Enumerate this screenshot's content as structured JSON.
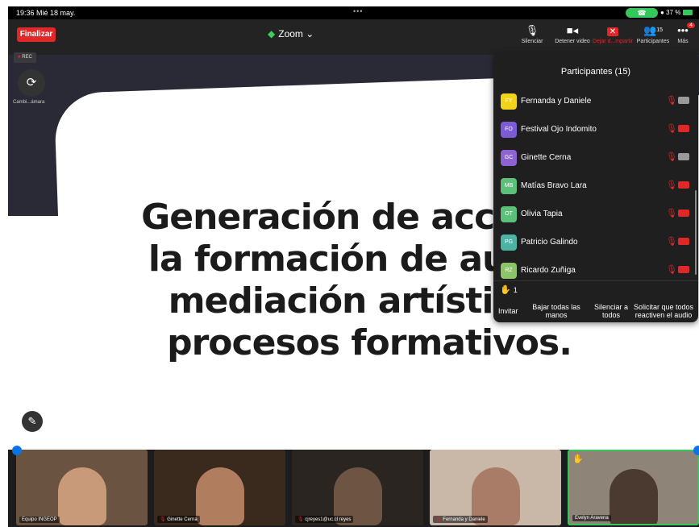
{
  "status_bar": {
    "time": "19:36  Mié 18 may.",
    "battery": "37 %"
  },
  "toolbar": {
    "end_label": "Finalizar",
    "app_title": "Zoom",
    "items": [
      {
        "label": "Silenciar",
        "icon": "mic-icon"
      },
      {
        "label": "Detener video",
        "icon": "video-icon"
      },
      {
        "label": "Dejar d...mpartir",
        "icon": "stop-share-icon"
      },
      {
        "label": "Participantes",
        "icon": "participants-icon",
        "count": "15"
      },
      {
        "label": "Más",
        "icon": "more-icon",
        "badge": "4"
      }
    ]
  },
  "overlay": {
    "rec_label": "REC",
    "camera_label": "Cambi...ámara"
  },
  "slide": {
    "lines": [
      "Generación de acciones",
      "la formación de audien",
      "mediación artística y",
      "procesos formativos."
    ]
  },
  "participants_panel": {
    "title": "Participantes (15)",
    "list": [
      {
        "initials": "FY",
        "name": "Fernanda y Daniele",
        "color": "#f2d21b",
        "video_on": true
      },
      {
        "initials": "FO",
        "name": "Festival Ojo Indomito",
        "color": "#7b5cd6",
        "video_on": false
      },
      {
        "initials": "GC",
        "name": "Ginette Cerna",
        "color": "#8c63d0",
        "video_on": true
      },
      {
        "initials": "MB",
        "name": "Matías Bravo Lara",
        "color": "#5cc07a",
        "video_on": false
      },
      {
        "initials": "OT",
        "name": "Olivia Tapia",
        "color": "#5cc07a",
        "video_on": false
      },
      {
        "initials": "PG",
        "name": "Patricio Galindo",
        "color": "#4cb4a4",
        "video_on": false
      },
      {
        "initials": "RZ",
        "name": "Ricardo Zuñiga",
        "color": "#8cc46a",
        "video_on": false
      }
    ],
    "raised_hands": "1",
    "buttons": {
      "invite": "Invitar",
      "lower_hands": "Bajar todas las manos",
      "mute_all": "Silenciar a todos",
      "ask_unmute": "Solicitar que todos reactiven el audio"
    }
  },
  "video_strip": [
    {
      "label": "Equipo INGEOP",
      "muted": false,
      "hand": false,
      "bg": "#6a5340",
      "face": "#c99a7a"
    },
    {
      "label": "Ginette Cerna",
      "muted": true,
      "hand": false,
      "bg": "#3a2a1e",
      "face": "#b07e5e"
    },
    {
      "label": "cjreyes1@uc.cl reyes",
      "muted": true,
      "hand": false,
      "bg": "#2a2520",
      "face": "#6e5543"
    },
    {
      "label": "Fernanda y Daniele",
      "muted": true,
      "hand": false,
      "bg": "#c9b8a8",
      "face": "#a87c66"
    },
    {
      "label": "Evelyn Aravena",
      "muted": false,
      "hand": true,
      "bg": "#8e8478",
      "face": "#4a3a30"
    }
  ]
}
